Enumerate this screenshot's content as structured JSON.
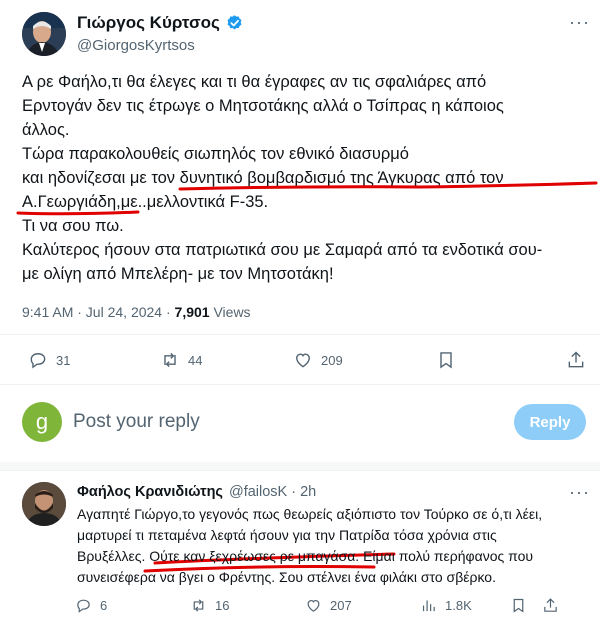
{
  "main_tweet": {
    "author_name": "Γιώργος Κύρτσος",
    "handle": "@GiorgosKyrtsos",
    "more": "···",
    "lines": [
      "Α ρε Φαήλο,τι θα έλεγες και τι θα έγραφες αν τις σφαλιάρες από",
      "Ερντογάν δεν τις έτρωγε ο Μητσοτάκης αλλά ο Τσίπρας η κάποιος",
      "άλλος.",
      "Τώρα παρακολουθείς σιωπηλός τον εθνικό διασυρμό",
      "και ηδονίζεσαι με τον δυνητικό βομβαρδισμό της Άγκυρας από τον",
      "Α.Γεωργιάδη,με..μελλοντικά F-35.",
      "Τι να σου πω.",
      "Καλύτερος ήσουν στα πατριωτικά σου με Σαμαρά από τα ενδοτικά σου-",
      "με ολίγη από Μπελέρη- με τον Μητσοτάκη!"
    ],
    "time": "9:41 AM · Jul 24, 2024 · ",
    "views_count": "7,901",
    "views_label": " Views",
    "actions": {
      "replies": "31",
      "retweets": "44",
      "likes": "209"
    }
  },
  "compose": {
    "avatar_letter": "g",
    "placeholder": "Post your reply",
    "button": "Reply",
    "avatar_color": "#7fb539"
  },
  "reply_tweet": {
    "author_name": "Φαήλος Κρανιδιώτης",
    "handle": "@failosK · 2h",
    "more": "···",
    "lines": [
      "Αγαπητέ Γιώργο,το γεγονός πως θεωρείς αξιόπιστο τον Τούρκο σε ό,τι λέει,",
      "μαρτυρεί τι πεταμένα λεφτά ήσουν για την Πατρίδα τόσα χρόνια στις",
      "Βρυξέλλες. Ούτε καν ξεχρέωσες ρε μπαγάσα. Είμαι πολύ περήφανος που",
      "συνεισέφερα να βγει ο Φρέντης. Σου στέλνει ένα φιλάκι στο σβέρκο."
    ],
    "actions": {
      "replies": "6",
      "retweets": "16",
      "likes": "207",
      "views": "1.8K"
    }
  },
  "colors": {
    "verified": "#1d9bf0",
    "reply_button": "#8ecdf8",
    "underline": "#e00000"
  }
}
